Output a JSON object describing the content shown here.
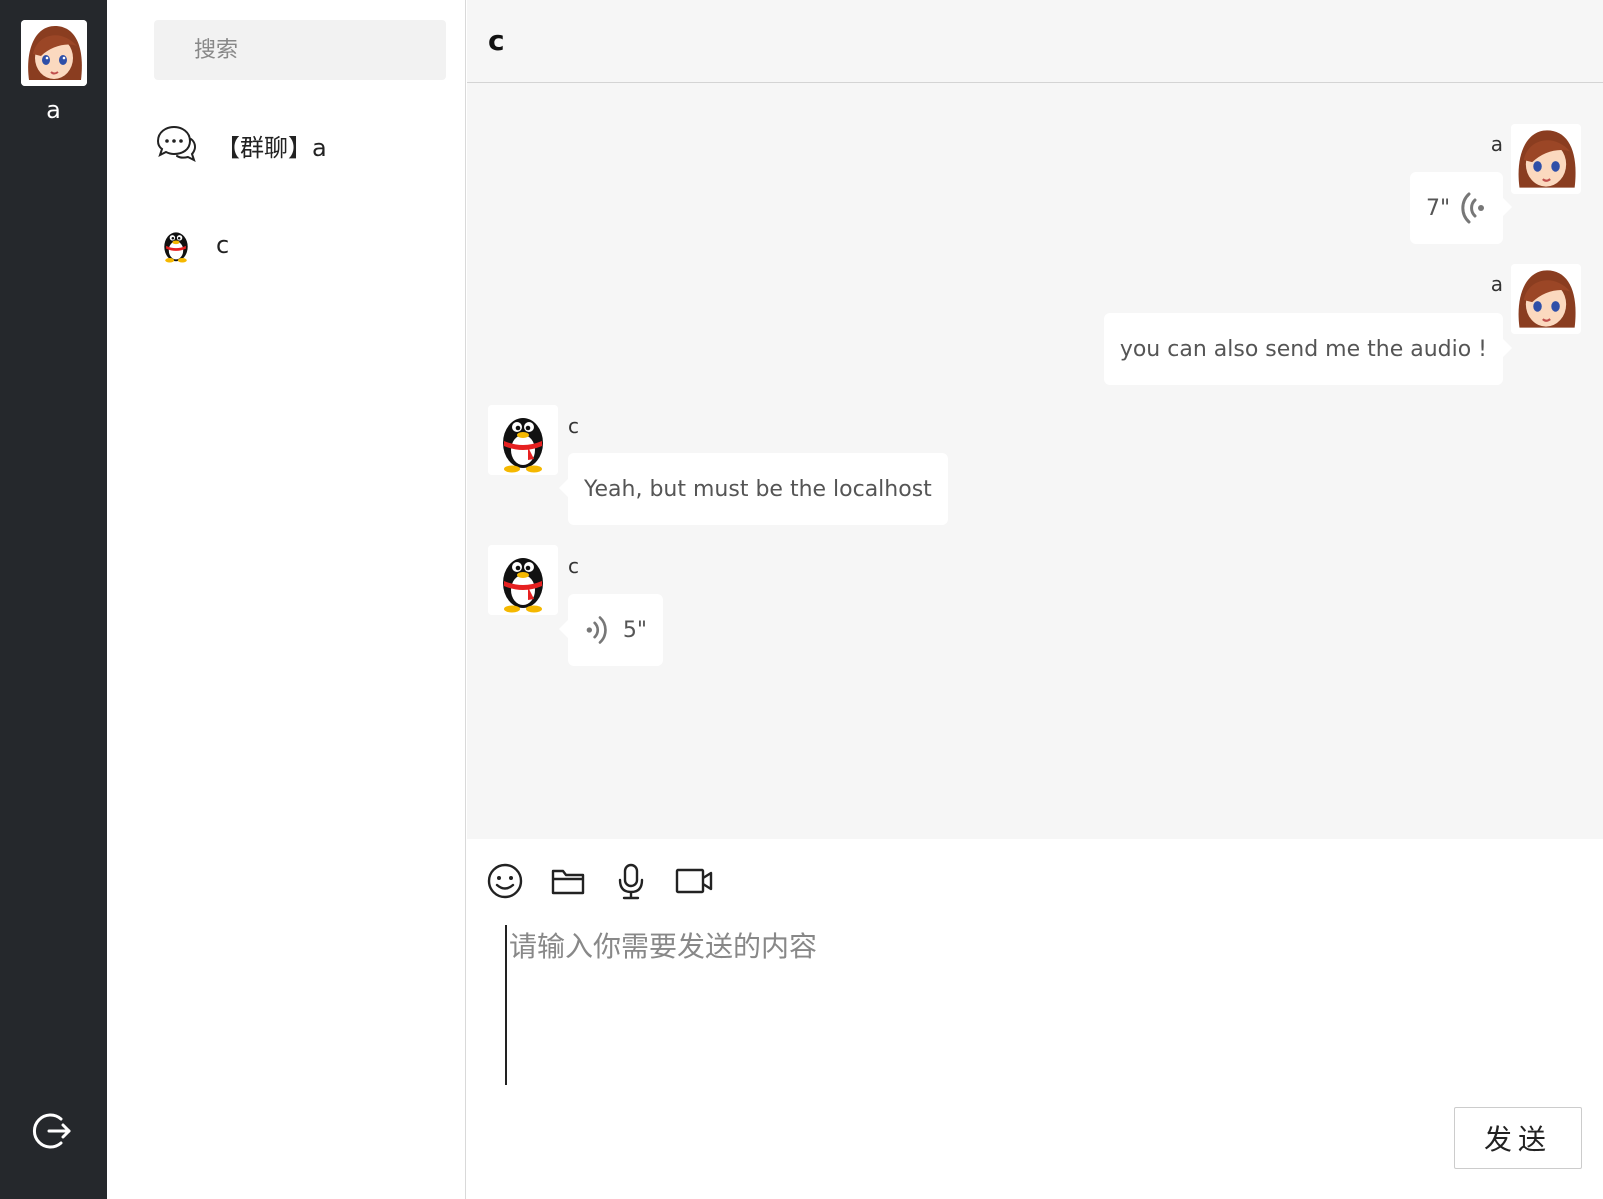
{
  "current_user": {
    "name": "a",
    "avatar_icon": "girl-avatar-icon"
  },
  "sidebar": {
    "logout_icon": "logout-icon"
  },
  "search": {
    "placeholder": "搜索"
  },
  "contacts": [
    {
      "label": "【群聊】a",
      "icon": "group-chat-icon"
    },
    {
      "label": "c",
      "icon": "penguin-avatar-icon"
    }
  ],
  "chat": {
    "title": "c",
    "messages": [
      {
        "sender": "a",
        "side": "right",
        "type": "audio",
        "duration": "7\""
      },
      {
        "sender": "a",
        "side": "right",
        "type": "text",
        "text": "you can also send me the audio !"
      },
      {
        "sender": "c",
        "side": "left",
        "type": "text",
        "text": "Yeah, but must be the localhost"
      },
      {
        "sender": "c",
        "side": "left",
        "type": "audio",
        "duration": "5\""
      }
    ]
  },
  "composer": {
    "placeholder": "请输入你需要发送的内容",
    "tools": [
      "emoji-icon",
      "folder-icon",
      "microphone-icon",
      "video-camera-icon"
    ],
    "send_label": "发送"
  },
  "colors": {
    "rail": "#25282c",
    "chat_bg": "#f6f6f6",
    "bubble": "#ffffff"
  }
}
